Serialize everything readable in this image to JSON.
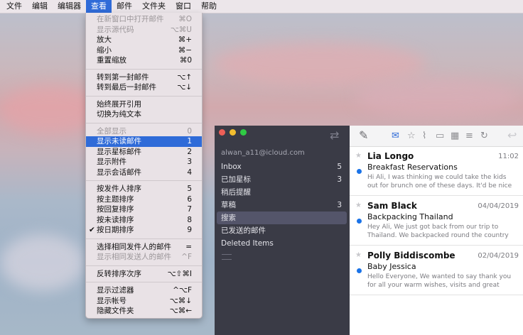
{
  "menubar": {
    "items": [
      {
        "label": "文件"
      },
      {
        "label": "编辑"
      },
      {
        "label": "编辑器"
      },
      {
        "label": "查看"
      },
      {
        "label": "邮件"
      },
      {
        "label": "文件夹"
      },
      {
        "label": "窗口"
      },
      {
        "label": "帮助"
      }
    ]
  },
  "view_menu": {
    "groups": [
      [
        {
          "label": "在新窗口中打开邮件",
          "shortcut": "⌘O",
          "disabled": true
        },
        {
          "label": "显示源代码",
          "shortcut": "⌥⌘U",
          "disabled": true
        },
        {
          "label": "放大",
          "shortcut": "⌘+"
        },
        {
          "label": "缩小",
          "shortcut": "⌘−"
        },
        {
          "label": "重置缩放",
          "shortcut": "⌘0"
        }
      ],
      [
        {
          "label": "转到第一封邮件",
          "shortcut": "⌥↑"
        },
        {
          "label": "转到最后一封邮件",
          "shortcut": "⌥↓"
        }
      ],
      [
        {
          "label": "始终展开引用",
          "shortcut": ""
        },
        {
          "label": "切换为纯文本",
          "shortcut": ""
        }
      ],
      [
        {
          "label": "全部显示",
          "shortcut": "0",
          "disabled": true
        },
        {
          "label": "显示未读邮件",
          "shortcut": "1",
          "selected": true
        },
        {
          "label": "显示星标邮件",
          "shortcut": "2"
        },
        {
          "label": "显示附件",
          "shortcut": "3"
        },
        {
          "label": "显示会话邮件",
          "shortcut": "4"
        }
      ],
      [
        {
          "label": "按发件人排序",
          "shortcut": "5"
        },
        {
          "label": "按主题排序",
          "shortcut": "6"
        },
        {
          "label": "按回复排序",
          "shortcut": "7"
        },
        {
          "label": "按未读排序",
          "shortcut": "8"
        },
        {
          "label": "按日期排序",
          "shortcut": "9",
          "checked": true
        }
      ],
      [
        {
          "label": "选择相同发件人的邮件",
          "shortcut": "="
        },
        {
          "label": "显示相同发送人的邮件",
          "shortcut": "^F",
          "disabled": true
        }
      ],
      [
        {
          "label": "反转排序次序",
          "shortcut": "⌥⇧⌘I"
        }
      ],
      [
        {
          "label": "显示过滤器",
          "shortcut": "^⌥F"
        },
        {
          "label": "显示帐号",
          "shortcut": "⌥⌘↓"
        },
        {
          "label": "隐藏文件夹",
          "shortcut": "⌥⌘←"
        }
      ]
    ],
    "check_glyph": "✔"
  },
  "sidebar": {
    "account": "alwan_a11@icloud.com",
    "folders": [
      {
        "label": "Inbox",
        "count": "5"
      },
      {
        "label": "已加星标",
        "count": "3"
      },
      {
        "label": "稍后提醒",
        "count": ""
      },
      {
        "label": "草稿",
        "count": "3"
      },
      {
        "label": "搜索",
        "count": "",
        "selected": true
      },
      {
        "label": "已发送的邮件",
        "count": ""
      },
      {
        "label": "Deleted Items",
        "count": ""
      }
    ]
  },
  "toolbar": {
    "icons": [
      "compose-icon",
      "envelope-icon",
      "star-icon",
      "attachment-icon",
      "chat-icon",
      "calendar-icon",
      "sort-icon",
      "refresh-icon",
      "back-icon"
    ]
  },
  "messages": [
    {
      "sender": "Lia Longo",
      "date": "11:02",
      "subject": "Breakfast Reservations",
      "preview": "Hi Ali, I was thinking we could take the kids out for brunch one of these days. It'd be nice to get…"
    },
    {
      "sender": "Sam Black",
      "date": "04/04/2019",
      "subject": "Backpacking Thailand",
      "preview": "Hey Ali, We just got back from our trip to Thailand. We backpacked round the country for…"
    },
    {
      "sender": "Polly Biddiscombe",
      "date": "02/04/2019",
      "subject": "Baby Jessica",
      "preview": "Hello Everyone, We wanted to say thank you for all your warm wishes, visits and great advice y…"
    }
  ],
  "colors": {
    "accent": "#2f6bd8",
    "unread_dot": "#1a73e8",
    "sidebar_bg": "#3a3b46"
  }
}
